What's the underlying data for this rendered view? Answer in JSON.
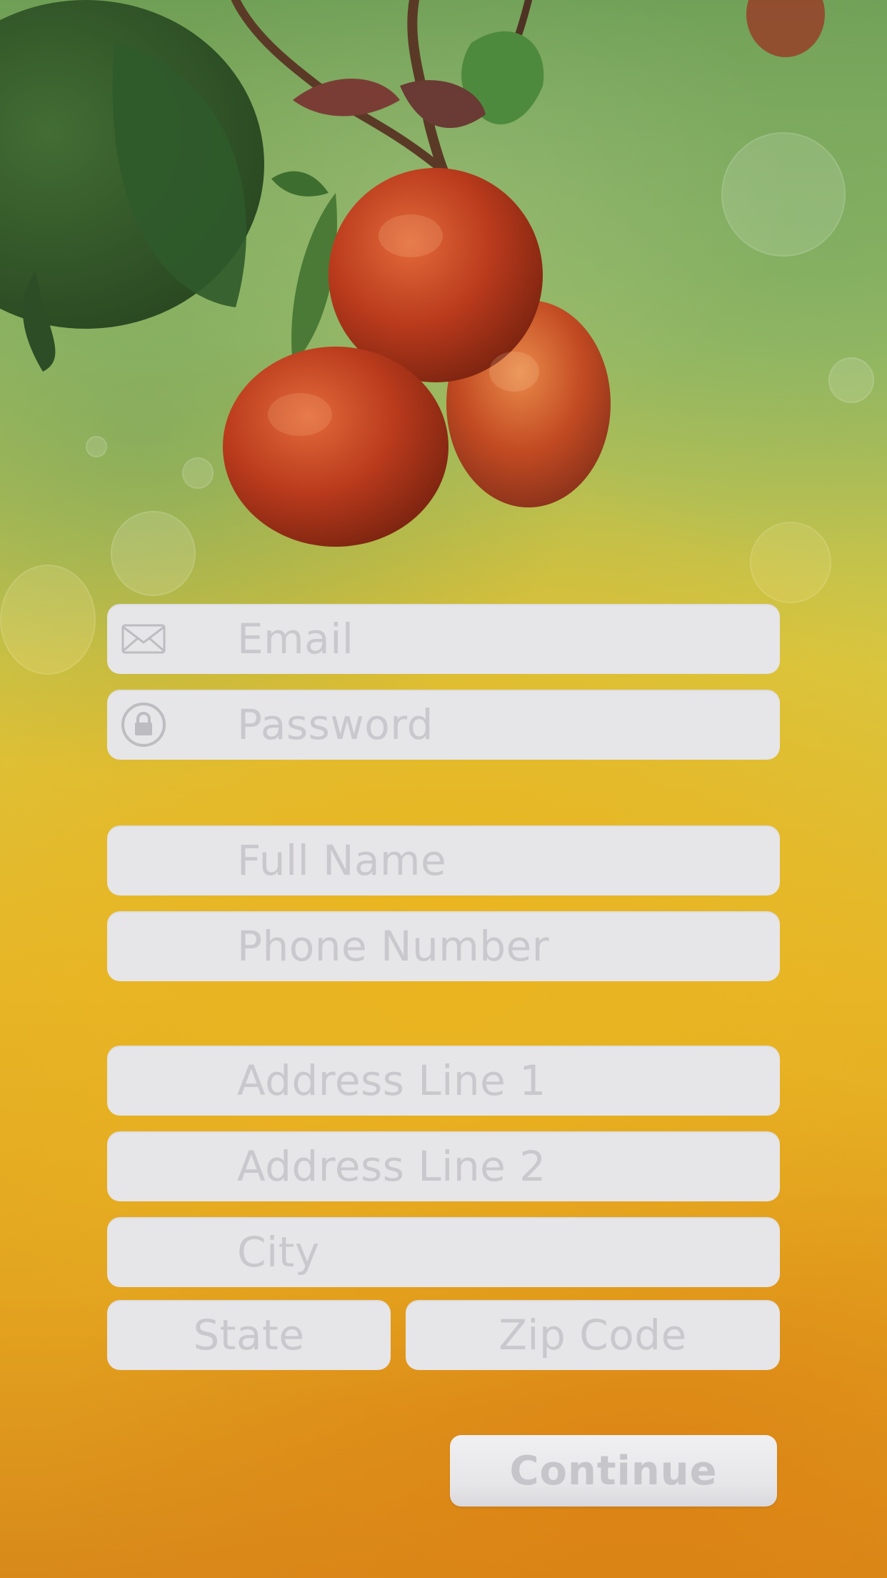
{
  "form": {
    "email_placeholder": "Email",
    "password_placeholder": "Password",
    "full_name_placeholder": "Full Name",
    "phone_placeholder": "Phone Number",
    "address1_placeholder": "Address Line 1",
    "address2_placeholder": "Address Line 2",
    "city_placeholder": "City",
    "state_placeholder": "State",
    "zip_placeholder": "Zip Code"
  },
  "actions": {
    "continue_label": "Continue"
  },
  "icons": {
    "email": "envelope-icon",
    "password": "lock-icon"
  },
  "colors": {
    "field_bg": "#e6e5e8",
    "placeholder": "#c9c8cc",
    "icon": "#bdbcc0"
  }
}
